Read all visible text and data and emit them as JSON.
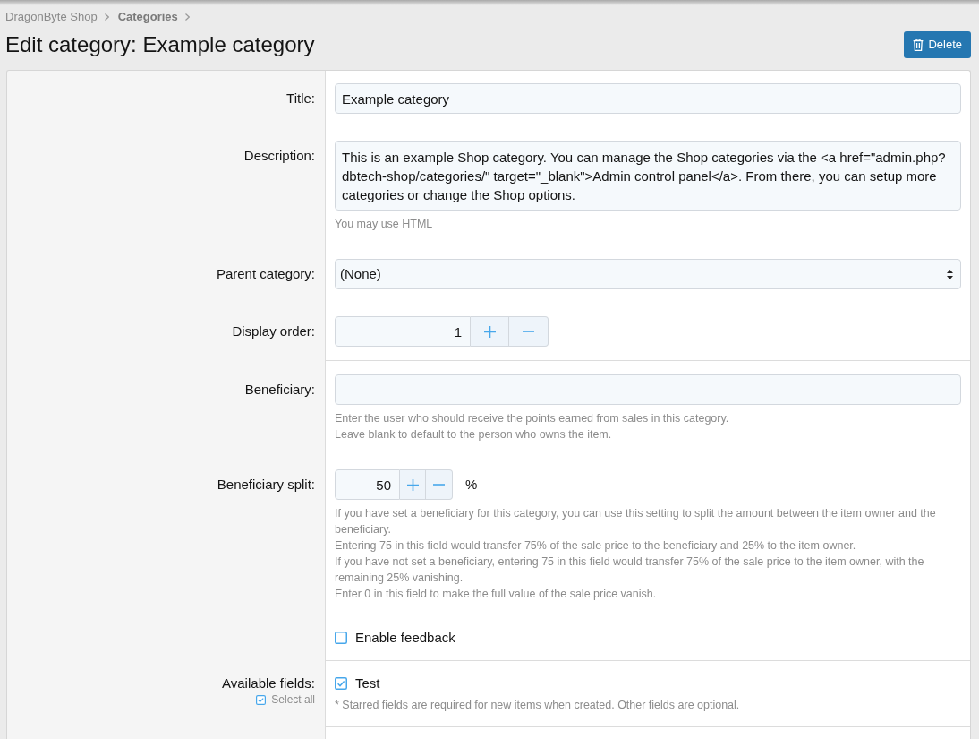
{
  "breadcrumb": [
    {
      "label": "DragonByte Shop",
      "bold": false
    },
    {
      "label": "Categories",
      "bold": true
    }
  ],
  "page_title": "Edit category: Example category",
  "delete_button": {
    "label": "Delete"
  },
  "form": {
    "sections": [
      {
        "rows": [
          {
            "kind": "text",
            "label": "Title:",
            "value": "Example category"
          },
          {
            "kind": "textarea",
            "label": "Description:",
            "value": "This is an example Shop category. You can manage the Shop categories via the <a href=\"admin.php?dbtech-shop/categories/\" target=\"_blank\">Admin control panel</a>. From there, you can setup more categories or change the Shop options.",
            "hints": [
              "You may use HTML"
            ]
          },
          {
            "kind": "select",
            "label": "Parent category:",
            "value": "(None)"
          },
          {
            "kind": "number",
            "label": "Display order:",
            "value": "1"
          }
        ]
      },
      {
        "rows": [
          {
            "kind": "text",
            "label": "Beneficiary:",
            "hints": [
              "Enter the user who should receive the points earned from sales in this category.",
              "Leave blank to default to the person who owns the item."
            ]
          },
          {
            "kind": "percent",
            "label": "Beneficiary split:",
            "value": "50",
            "unit": "%",
            "hints": [
              "If you have set a beneficiary for this category, you can use this setting to split the amount between the item owner and the beneficiary.",
              "Entering 75 in this field would transfer 75% of the sale price to the beneficiary and 25% to the item owner.",
              "If you have not set a beneficiary, entering 75 in this field would transfer 75% of the sale price to the item owner, with the remaining 25% vanishing.",
              "Enter 0 in this field to make the full value of the sale price vanish."
            ]
          },
          {
            "kind": "checkbox",
            "option": {
              "label": "Enable feedback",
              "checked": false
            }
          }
        ]
      },
      {
        "rows": [
          {
            "kind": "checklist",
            "label": "Available fields:",
            "select_all": {
              "label": "Select all",
              "checked": true
            },
            "options": [
              {
                "label": "Test",
                "checked": true
              }
            ],
            "hints": [
              "* Starred fields are required for new items when created. Other fields are optional."
            ]
          }
        ]
      }
    ]
  }
}
